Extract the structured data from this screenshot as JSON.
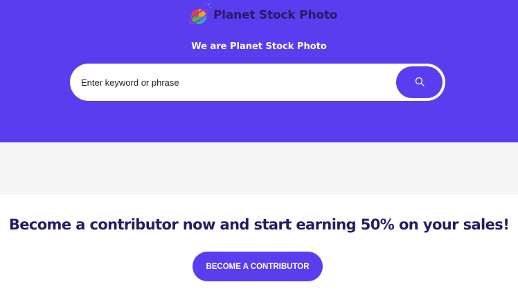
{
  "header": {
    "brand_name": "Planet Stock Photo",
    "logo_icon": "planet-logo-icon"
  },
  "hero": {
    "tagline": "We are Planet Stock Photo",
    "search": {
      "placeholder": "Enter keyword or phrase",
      "value": "",
      "button_icon": "search-icon"
    }
  },
  "cta": {
    "heading": "Become a contributor now and start earning 50% on your sales!",
    "button_label": "BECOME A CONTRIBUTOR"
  },
  "colors": {
    "brand_purple": "#5b3df0",
    "dark_text": "#2a1a63",
    "grey_band": "#f5f5f5"
  }
}
